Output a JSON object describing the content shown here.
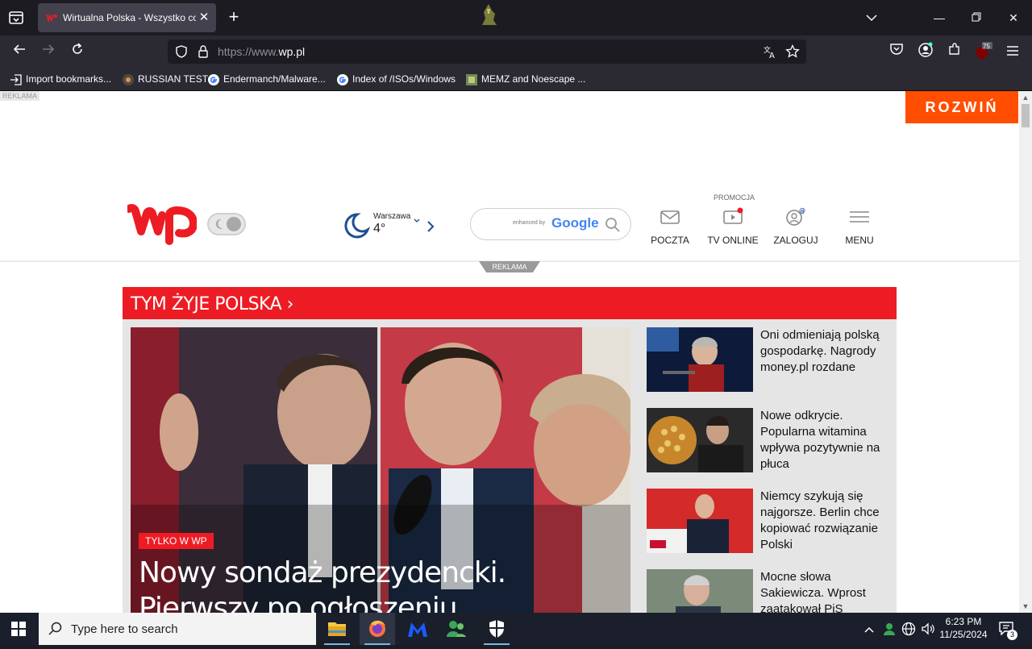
{
  "browser": {
    "tab": {
      "title": "Wirtualna Polska - Wszystko co",
      "favicon": "wp-favicon"
    },
    "url": {
      "prefix": "https://www.",
      "domain": "wp.pl"
    },
    "extension_badge": "75",
    "bookmarks": [
      {
        "label": "Import bookmarks...",
        "icon": "import-icon"
      },
      {
        "label": "RUSSIAN TEST",
        "icon": "bookmark-favicon"
      },
      {
        "label": "Endermanch/Malware...",
        "icon": "google-favicon"
      },
      {
        "label": "Index of /ISOs/Windows",
        "icon": "google-favicon"
      },
      {
        "label": "MEMZ and Noescape ...",
        "icon": "image-favicon"
      }
    ]
  },
  "page": {
    "ad_label": "REKLAMA",
    "expand_button": "ROZWIŃ",
    "weather": {
      "city": "Warszawa",
      "temp": "4°"
    },
    "search": {
      "enhanced": "enhanced by",
      "brand": "Google"
    },
    "promo_label": "PROMOCJA",
    "nav": {
      "mail": "POCZTA",
      "tv": "TV ONLINE",
      "login": "ZALOGUJ",
      "menu": "MENU"
    },
    "reklama_pill": "REKLAMA",
    "section_title": "TYM ŻYJE POLSKA",
    "hero": {
      "badge": "TYLKO W WP",
      "title": "Nowy sondaż prezydencki. Pierwszy po ogłoszeniu kandydatów"
    },
    "items": [
      {
        "text": "Oni odmieniają polską gospodarkę. Nagrody money.pl rozdane"
      },
      {
        "text": "Nowe odkrycie. Popularna witamina wpływa pozytywnie na płuca"
      },
      {
        "text": "Niemcy szykują się najgorsze. Berlin chce kopiować rozwiązanie Polski"
      },
      {
        "text": "Mocne słowa Sakiewicza. Wprost zaatakował PiS"
      }
    ]
  },
  "taskbar": {
    "search_placeholder": "Type here to search",
    "time": "6:23 PM",
    "date": "11/25/2024",
    "notifications": "3"
  },
  "colors": {
    "wp_red": "#ed1c24",
    "rozwin_orange": "#ff4e00",
    "chrome_dark": "#1c1b22"
  }
}
